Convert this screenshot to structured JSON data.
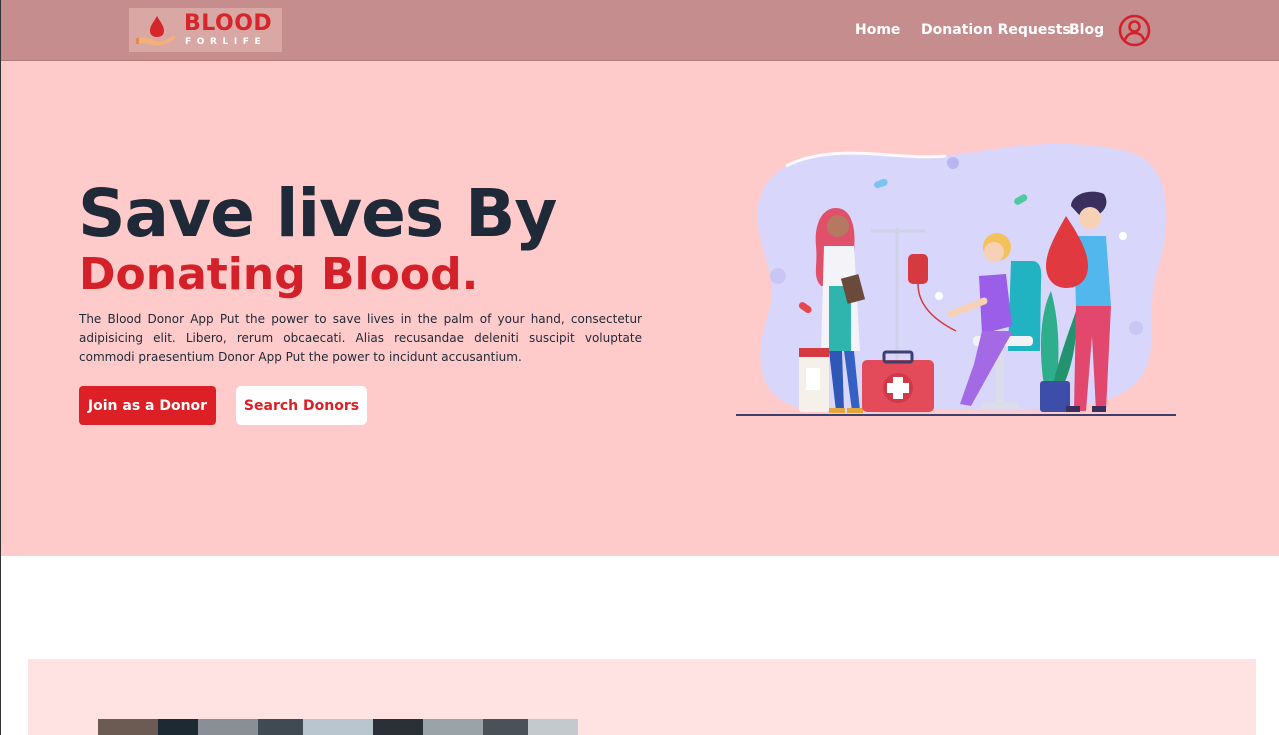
{
  "navbar": {
    "logo_word": "BLOOD",
    "logo_sub": "FORLIFE",
    "links": [
      "Home",
      "Donation Requests",
      "Blog"
    ],
    "user_icon": "user-circle-icon"
  },
  "hero": {
    "title": "Save lives By",
    "subtitle": "Donating Blood.",
    "description": "The Blood Donor App Put the power to save lives in the palm of your hand, consectetur adipisicing elit. Libero, rerum obcaecati. Alias recusandae deleniti suscipit voluptate commodi praesentium Donor App Put the power to incidunt accusantium.",
    "primary_button": "Join as a Donor",
    "secondary_button": "Search Donors"
  },
  "colors": {
    "navbar": "#c58d8d",
    "hero_bg": "#ffcaca",
    "accent_red": "#dc2026",
    "title_dark": "#1f2937",
    "lower_card": "#ffe2e2"
  }
}
